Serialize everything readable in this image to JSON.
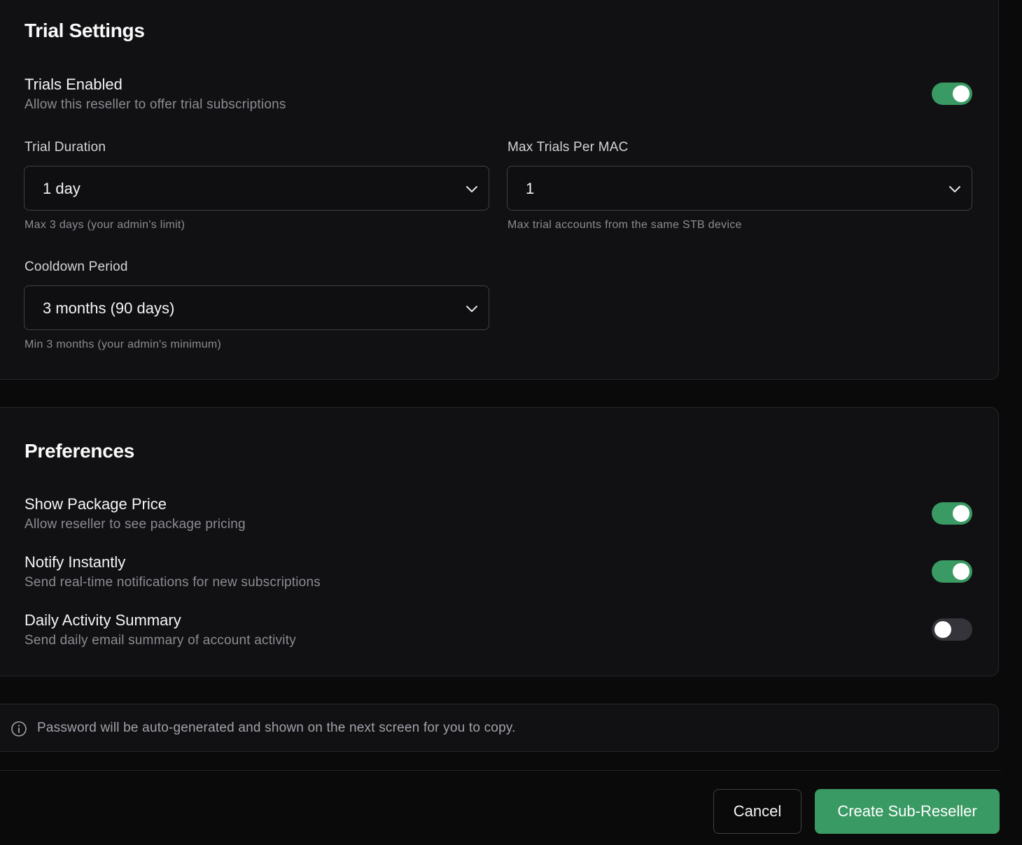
{
  "trial_settings": {
    "title": "Trial Settings",
    "trials_enabled": {
      "label": "Trials Enabled",
      "description": "Allow this reseller to offer trial subscriptions",
      "on": true
    },
    "trial_duration": {
      "label": "Trial Duration",
      "value": "1 day",
      "hint": "Max 3 days (your admin's limit)"
    },
    "max_trials_per_mac": {
      "label": "Max Trials Per MAC",
      "value": "1",
      "hint": "Max trial accounts from the same STB device"
    },
    "cooldown_period": {
      "label": "Cooldown Period",
      "value": "3 months (90 days)",
      "hint": "Min 3 months (your admin's minimum)"
    }
  },
  "preferences": {
    "title": "Preferences",
    "items": [
      {
        "label": "Show Package Price",
        "description": "Allow reseller to see package pricing",
        "on": true
      },
      {
        "label": "Notify Instantly",
        "description": "Send real-time notifications for new subscriptions",
        "on": true
      },
      {
        "label": "Daily Activity Summary",
        "description": "Send daily email summary of account activity",
        "on": false
      }
    ]
  },
  "info": {
    "icon": "info-icon",
    "text": "Password will be auto-generated and shown on the next screen for you to copy."
  },
  "footer": {
    "cancel_label": "Cancel",
    "create_label": "Create Sub-Reseller"
  },
  "colors": {
    "accent": "#3a9a63",
    "toggle_off": "#34343a",
    "background": "#0a0a0b",
    "card": "#111113"
  }
}
